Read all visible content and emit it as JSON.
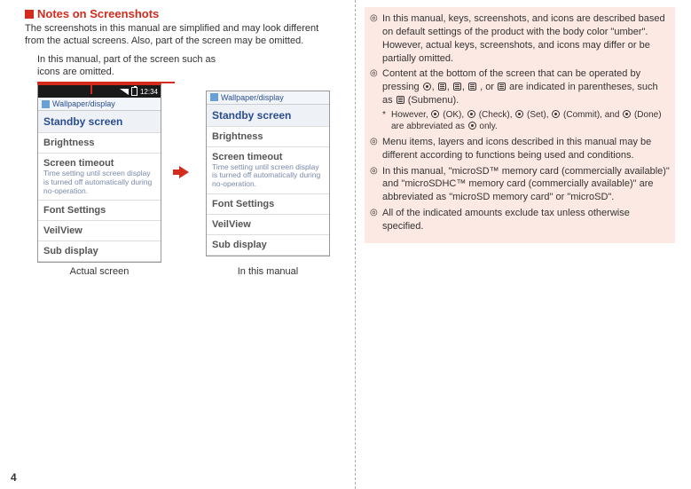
{
  "heading": "Notes on Screenshots",
  "intro": "The screenshots in this manual are simplified and may look different from the actual screens. Also, part of the screen may be omitted.",
  "caption_note": "In this manual, part of the screen such as icons are omitted.",
  "phone": {
    "status_time": "12:34",
    "breadcrumb": "Wallpaper/display",
    "items": {
      "standby": "Standby screen",
      "brightness": "Brightness",
      "timeout_title": "Screen timeout",
      "timeout_sub": "Time setting until screen display is turned off automatically during no-operation.",
      "font": "Font Settings",
      "veil": "VeilView",
      "subdisplay": "Sub display"
    }
  },
  "captions": {
    "actual": "Actual screen",
    "manual": "In this manual"
  },
  "notes": {
    "n1_a": "In this manual, keys, screenshots, and icons are described based on default settings of the product with the body color \"umber\". However, actual keys, screenshots, and icons may differ or be partially omitted.",
    "n2_a": "Content at the bottom of the screen that can be operated by pressing ",
    "n2_b": ", or ",
    "n2_c": " are indicated in parentheses, such as ",
    "n2_d": " (Submenu).",
    "n2_sub_a": "However, ",
    "n2_sub_ok": " (OK), ",
    "n2_sub_check": " (Check), ",
    "n2_sub_set": " (Set), ",
    "n2_sub_commit": " (Commit), and ",
    "n2_sub_done": " (Done) are abbreviated as ",
    "n2_sub_end": " only.",
    "n3": "Menu items, layers and icons described in this manual may be different according to functions being used and conditions.",
    "n4": "In this manual, \"microSD™ memory card (commercially available)\" and \"microSDHC™ memory card (commercially available)\" are abbreviated as \"microSD memory card\" or \"microSD\".",
    "n5": "All of the indicated amounts exclude tax unless otherwise specified."
  },
  "page_number": "4"
}
